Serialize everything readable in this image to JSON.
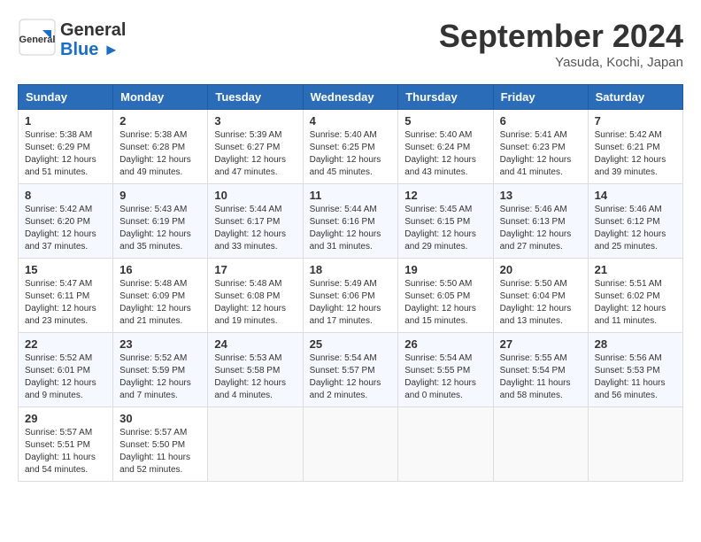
{
  "header": {
    "logo_general": "General",
    "logo_blue": "Blue",
    "month_title": "September 2024",
    "location": "Yasuda, Kochi, Japan"
  },
  "weekdays": [
    "Sunday",
    "Monday",
    "Tuesday",
    "Wednesday",
    "Thursday",
    "Friday",
    "Saturday"
  ],
  "weeks": [
    [
      {
        "day": "1",
        "sunrise": "5:38 AM",
        "sunset": "6:29 PM",
        "daylight": "12 hours and 51 minutes."
      },
      {
        "day": "2",
        "sunrise": "5:38 AM",
        "sunset": "6:28 PM",
        "daylight": "12 hours and 49 minutes."
      },
      {
        "day": "3",
        "sunrise": "5:39 AM",
        "sunset": "6:27 PM",
        "daylight": "12 hours and 47 minutes."
      },
      {
        "day": "4",
        "sunrise": "5:40 AM",
        "sunset": "6:25 PM",
        "daylight": "12 hours and 45 minutes."
      },
      {
        "day": "5",
        "sunrise": "5:40 AM",
        "sunset": "6:24 PM",
        "daylight": "12 hours and 43 minutes."
      },
      {
        "day": "6",
        "sunrise": "5:41 AM",
        "sunset": "6:23 PM",
        "daylight": "12 hours and 41 minutes."
      },
      {
        "day": "7",
        "sunrise": "5:42 AM",
        "sunset": "6:21 PM",
        "daylight": "12 hours and 39 minutes."
      }
    ],
    [
      {
        "day": "8",
        "sunrise": "5:42 AM",
        "sunset": "6:20 PM",
        "daylight": "12 hours and 37 minutes."
      },
      {
        "day": "9",
        "sunrise": "5:43 AM",
        "sunset": "6:19 PM",
        "daylight": "12 hours and 35 minutes."
      },
      {
        "day": "10",
        "sunrise": "5:44 AM",
        "sunset": "6:17 PM",
        "daylight": "12 hours and 33 minutes."
      },
      {
        "day": "11",
        "sunrise": "5:44 AM",
        "sunset": "6:16 PM",
        "daylight": "12 hours and 31 minutes."
      },
      {
        "day": "12",
        "sunrise": "5:45 AM",
        "sunset": "6:15 PM",
        "daylight": "12 hours and 29 minutes."
      },
      {
        "day": "13",
        "sunrise": "5:46 AM",
        "sunset": "6:13 PM",
        "daylight": "12 hours and 27 minutes."
      },
      {
        "day": "14",
        "sunrise": "5:46 AM",
        "sunset": "6:12 PM",
        "daylight": "12 hours and 25 minutes."
      }
    ],
    [
      {
        "day": "15",
        "sunrise": "5:47 AM",
        "sunset": "6:11 PM",
        "daylight": "12 hours and 23 minutes."
      },
      {
        "day": "16",
        "sunrise": "5:48 AM",
        "sunset": "6:09 PM",
        "daylight": "12 hours and 21 minutes."
      },
      {
        "day": "17",
        "sunrise": "5:48 AM",
        "sunset": "6:08 PM",
        "daylight": "12 hours and 19 minutes."
      },
      {
        "day": "18",
        "sunrise": "5:49 AM",
        "sunset": "6:06 PM",
        "daylight": "12 hours and 17 minutes."
      },
      {
        "day": "19",
        "sunrise": "5:50 AM",
        "sunset": "6:05 PM",
        "daylight": "12 hours and 15 minutes."
      },
      {
        "day": "20",
        "sunrise": "5:50 AM",
        "sunset": "6:04 PM",
        "daylight": "12 hours and 13 minutes."
      },
      {
        "day": "21",
        "sunrise": "5:51 AM",
        "sunset": "6:02 PM",
        "daylight": "12 hours and 11 minutes."
      }
    ],
    [
      {
        "day": "22",
        "sunrise": "5:52 AM",
        "sunset": "6:01 PM",
        "daylight": "12 hours and 9 minutes."
      },
      {
        "day": "23",
        "sunrise": "5:52 AM",
        "sunset": "5:59 PM",
        "daylight": "12 hours and 7 minutes."
      },
      {
        "day": "24",
        "sunrise": "5:53 AM",
        "sunset": "5:58 PM",
        "daylight": "12 hours and 4 minutes."
      },
      {
        "day": "25",
        "sunrise": "5:54 AM",
        "sunset": "5:57 PM",
        "daylight": "12 hours and 2 minutes."
      },
      {
        "day": "26",
        "sunrise": "5:54 AM",
        "sunset": "5:55 PM",
        "daylight": "12 hours and 0 minutes."
      },
      {
        "day": "27",
        "sunrise": "5:55 AM",
        "sunset": "5:54 PM",
        "daylight": "11 hours and 58 minutes."
      },
      {
        "day": "28",
        "sunrise": "5:56 AM",
        "sunset": "5:53 PM",
        "daylight": "11 hours and 56 minutes."
      }
    ],
    [
      {
        "day": "29",
        "sunrise": "5:57 AM",
        "sunset": "5:51 PM",
        "daylight": "11 hours and 54 minutes."
      },
      {
        "day": "30",
        "sunrise": "5:57 AM",
        "sunset": "5:50 PM",
        "daylight": "11 hours and 52 minutes."
      },
      null,
      null,
      null,
      null,
      null
    ]
  ]
}
